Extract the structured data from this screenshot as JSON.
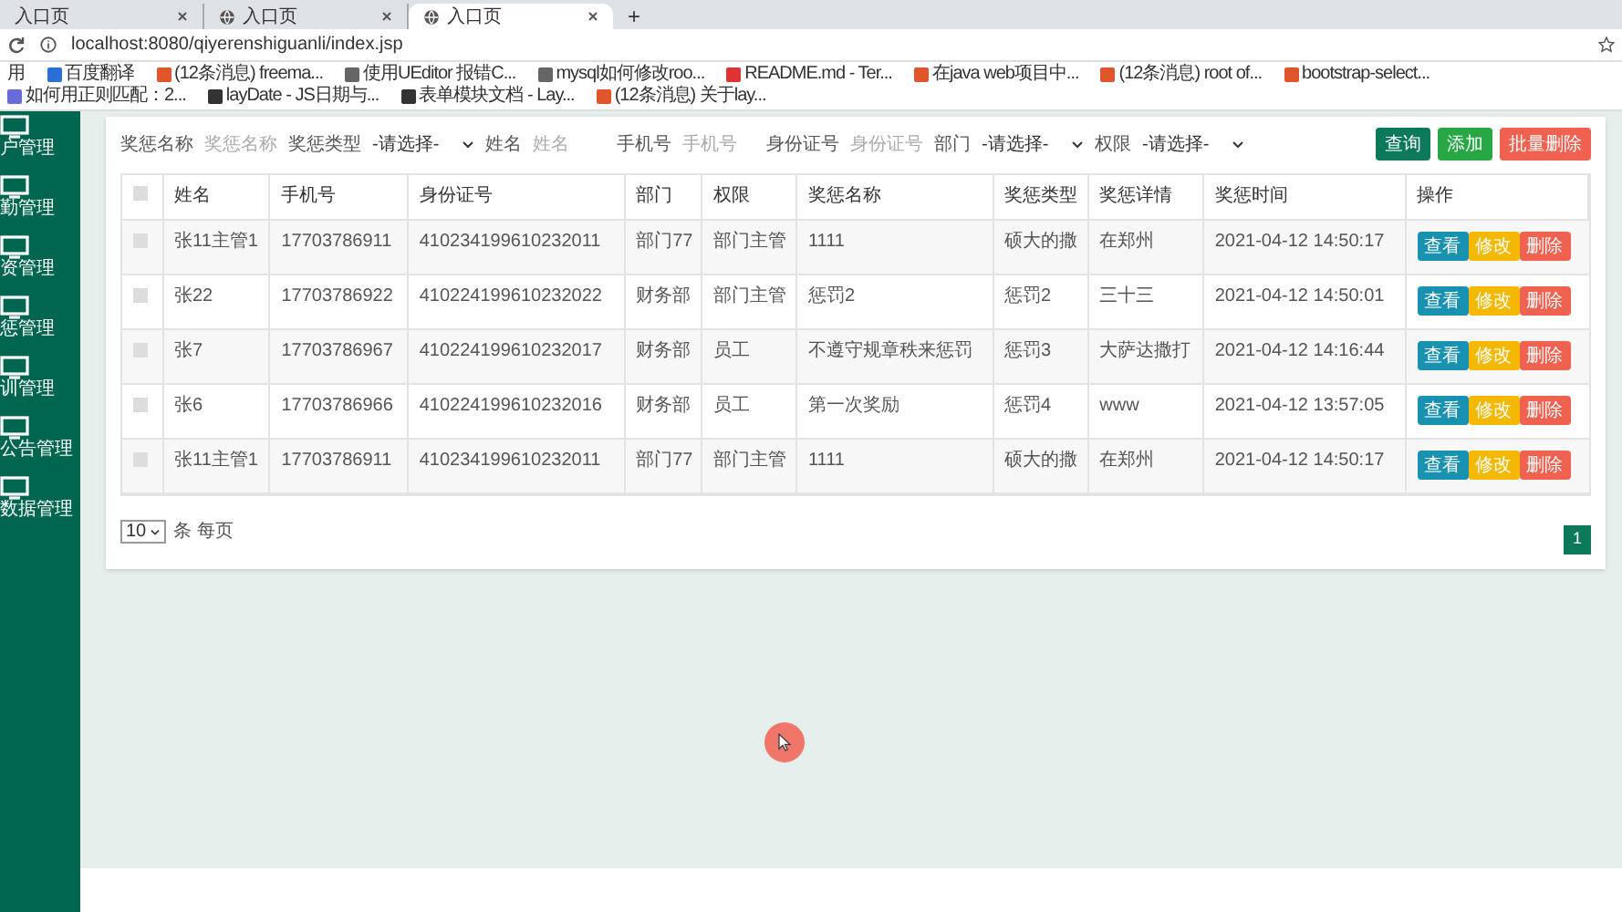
{
  "browser": {
    "tabs": [
      {
        "title": "入口页",
        "selected": false
      },
      {
        "title": "入口页",
        "selected": false
      },
      {
        "title": "入口页",
        "selected": true
      }
    ],
    "new_tab": "+",
    "url": "localhost:8080/qiyerenshiguanli/index.jsp",
    "bookmarks": [
      "用",
      "百度翻译",
      "(12条消息) freema...",
      "使用UEditor 报错C...",
      "mysql如何修改roo...",
      "README.md - Ter...",
      "在java web项目中...",
      "(12条消息) root of...",
      "bootstrap-select...",
      "如何用正则匹配：2...",
      "layDate - JS日期与...",
      "表单模块文档 - Lay...",
      "(12条消息) 关于lay..."
    ]
  },
  "sidebar": {
    "items": [
      {
        "label": "户管理"
      },
      {
        "label": "勤管理"
      },
      {
        "label": "资管理"
      },
      {
        "label": "惩管理"
      },
      {
        "label": "训管理"
      },
      {
        "label": "公告管理"
      },
      {
        "label": "数据管理"
      }
    ]
  },
  "filters": [
    {
      "kind": "text",
      "label": "奖惩名称",
      "placeholder": "奖惩名称"
    },
    {
      "kind": "select",
      "label": "奖惩类型",
      "value": "-请选择-"
    },
    {
      "kind": "text",
      "label": "姓名",
      "placeholder": "姓名"
    },
    {
      "kind": "text",
      "label": "手机号",
      "placeholder": "手机号"
    },
    {
      "kind": "text",
      "label": "身份证号",
      "placeholder": "身份证号"
    },
    {
      "kind": "select",
      "label": "部门",
      "value": "-请选择-"
    },
    {
      "kind": "select",
      "label": "权限",
      "value": "-请选择-"
    }
  ],
  "toolbar_buttons": [
    {
      "kind": "query",
      "label": "查询"
    },
    {
      "kind": "add",
      "label": "添加"
    },
    {
      "kind": "delete",
      "label": "批量删除"
    }
  ],
  "table": {
    "columns": [
      "姓名",
      "手机号",
      "身份证号",
      "部门",
      "权限",
      "奖惩名称",
      "奖惩类型",
      "奖惩详情",
      "奖惩时间",
      "操作"
    ],
    "header_checked": false,
    "rows": [
      {
        "checked": false,
        "cells": [
          "张11主管1",
          "17703786911",
          "410234199610232011",
          "部门77",
          "部门主管",
          "1111",
          "硕大的撒",
          "在郑州",
          "2021-04-12 14:50:17"
        ],
        "actions": [
          {
            "kind": "view",
            "label": "查看"
          },
          {
            "kind": "edit",
            "label": "修改"
          },
          {
            "kind": "delete",
            "label": "删除"
          }
        ]
      },
      {
        "checked": false,
        "cells": [
          "张22",
          "17703786922",
          "410224199610232022",
          "财务部",
          "部门主管",
          "惩罚2",
          "惩罚2",
          "三十三",
          "2021-04-12 14:50:01"
        ],
        "actions": [
          {
            "kind": "view",
            "label": "查看"
          },
          {
            "kind": "edit",
            "label": "修改"
          },
          {
            "kind": "delete",
            "label": "删除"
          }
        ]
      },
      {
        "checked": false,
        "cells": [
          "张7",
          "17703786967",
          "410224199610232017",
          "财务部",
          "员工",
          "不遵守规章秩来惩罚",
          "惩罚3",
          "大萨达撒打",
          "2021-04-12 14:16:44"
        ],
        "actions": [
          {
            "kind": "view",
            "label": "查看"
          },
          {
            "kind": "edit",
            "label": "修改"
          },
          {
            "kind": "delete",
            "label": "删除"
          }
        ]
      },
      {
        "checked": false,
        "cells": [
          "张6",
          "17703786966",
          "410224199610232016",
          "财务部",
          "员工",
          "第一次奖励",
          "惩罚4",
          "www",
          "2021-04-12 13:57:05"
        ],
        "actions": [
          {
            "kind": "view",
            "label": "查看"
          },
          {
            "kind": "edit",
            "label": "修改"
          },
          {
            "kind": "delete",
            "label": "删除"
          }
        ]
      },
      {
        "checked": false,
        "cells": [
          "张11主管1",
          "17703786911",
          "410234199610232011",
          "部门77",
          "部门主管",
          "1111",
          "硕大的撒",
          "在郑州",
          "2021-04-12 14:50:17"
        ],
        "actions": [
          {
            "kind": "view",
            "label": "查看"
          },
          {
            "kind": "edit",
            "label": "修改"
          },
          {
            "kind": "delete",
            "label": "删除"
          }
        ]
      }
    ]
  },
  "page_size": {
    "value": "10",
    "suffix": "条 每页"
  },
  "pagination": [
    {
      "label": "1",
      "selected": true
    }
  ]
}
